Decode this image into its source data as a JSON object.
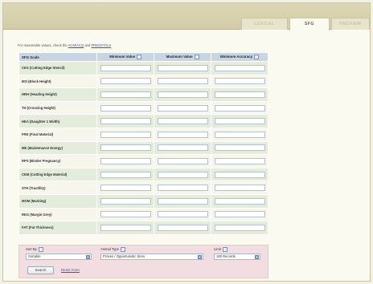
{
  "tabs": [
    {
      "label": "LEXICAL",
      "active": false
    },
    {
      "label": "SFG",
      "active": true
    },
    {
      "label": "PREVIEW",
      "active": false
    }
  ],
  "notice": {
    "prefix": "For reasonable values, check the",
    "link1": "ACM/ACQ",
    "middle": "and",
    "link2": "PRE/SFG/LS"
  },
  "table": {
    "headers": {
      "first": "SFG Scale",
      "min": "Minimum Value",
      "max": "Maximum Value",
      "acc": "Minimum Accuracy"
    },
    "rows": [
      "CES (Cutting Edge Stencil)",
      "BSI (Block Height)",
      "HRH (Heading Height)",
      "TH (Crossing Height)",
      "HEA (Daughter 1 Width)",
      "FRE (Final Material)",
      "ME (Maintenance Energy)",
      "RPS (Binder Pregnancy)",
      "CEM (Cutting Edge Material)",
      "STH (Tractility)",
      "MOM (Marking)",
      "REG (Margin Grey)",
      "FAT (Fat Thickness)"
    ]
  },
  "filters": {
    "sortby_label": "Sort By",
    "sortby_value": "Sortable",
    "animal_label": "Animal Type",
    "animal_value": "Proven / Opportunistic Sires",
    "limit_label": "Limit",
    "limit_value": "100 Records",
    "search_label": "Search",
    "reset_label": "Reset Form"
  }
}
